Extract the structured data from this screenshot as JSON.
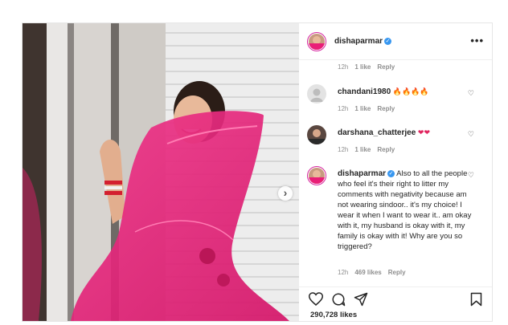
{
  "post": {
    "author": "dishaparmar",
    "more_label": "•••",
    "likes_count": "290,728 likes",
    "verified_mark": "✓",
    "carousel_next_glyph": "›"
  },
  "comments": [
    {
      "username": "",
      "text": "",
      "time": "12h",
      "likes": "1 like",
      "reply": "Reply"
    },
    {
      "username": "chandani1980",
      "text": "🔥🔥🔥🔥",
      "time": "12h",
      "likes": "1 like",
      "reply": "Reply"
    },
    {
      "username": "darshana_chatterjee",
      "text": "❤❤",
      "time": "12h",
      "likes": "1 like",
      "reply": "Reply"
    },
    {
      "username": "dishaparmar",
      "text": "Also to all the people who feel it's their right to litter my comments with negativity because am not wearing sindoor.. it's my choice! I wear it when I want to wear it.. am okay with it, my husband is okay with it, my family is okay with it! Why are you so triggered?",
      "time": "12h",
      "likes": "469 likes",
      "reply": "Reply"
    }
  ],
  "icons": {
    "like": "heart-icon",
    "comment": "comment-icon",
    "share": "share-icon",
    "save": "bookmark-icon",
    "more": "more-options-icon",
    "next": "chevron-right-icon"
  },
  "colors": {
    "dupatta": "#e91e77",
    "verified": "#3897f0",
    "story_ring": "#d6249f",
    "heart_red": "#e0245e",
    "fire": "#ff7a00"
  }
}
